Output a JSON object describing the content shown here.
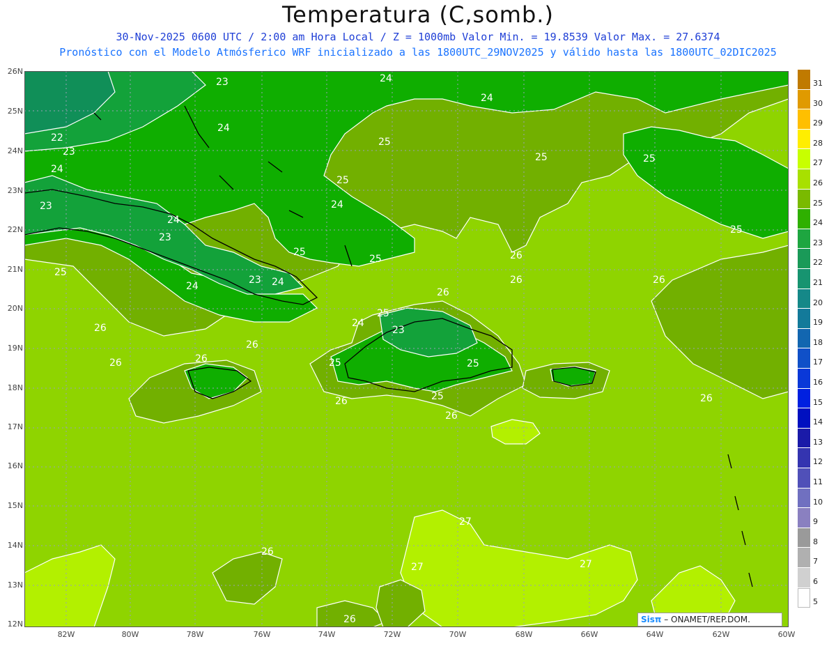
{
  "header": {
    "title": "Temperatura (C,somb.)",
    "subtitle": "30-Nov-2025  0600 UTC / 2:00 am Hora Local / Z = 1000mb   Valor Min. = 19.8539  Valor Max. = 27.6374",
    "subtitle2": "Pronóstico con el Modelo Atmósferico WRF inicializado a las 1800UTC_29NOV2025 y válido hasta las  1800UTC_02DIC2025"
  },
  "axes": {
    "lat_labels": [
      "26N",
      "25N",
      "24N",
      "23N",
      "22N",
      "21N",
      "20N",
      "19N",
      "18N",
      "17N",
      "16N",
      "15N",
      "14N",
      "13N",
      "12N"
    ],
    "lon_labels": [
      "82W",
      "80W",
      "78W",
      "76W",
      "74W",
      "72W",
      "70W",
      "68W",
      "66W",
      "64W",
      "62W",
      "60W"
    ]
  },
  "colorbar": {
    "levels": [
      "31",
      "30",
      "29",
      "28",
      "27",
      "26",
      "25",
      "24",
      "23",
      "22",
      "21",
      "20",
      "19",
      "18",
      "17",
      "16",
      "15",
      "14",
      "13",
      "12",
      "11",
      "10",
      "9",
      "8",
      "7",
      "6",
      "5"
    ],
    "colors": [
      "#c07a00",
      "#e09a00",
      "#ffbf00",
      "#ffee00",
      "#c8ff00",
      "#a8e000",
      "#7aba00",
      "#2fb000",
      "#1ea640",
      "#1a9a58",
      "#179470",
      "#158888",
      "#137a9a",
      "#1266b0",
      "#1050c8",
      "#0a38d8",
      "#0020e0",
      "#0010c0",
      "#1a1aa8",
      "#3434b0",
      "#5050b8",
      "#7070c0",
      "#8a80c0",
      "#9a9a9a",
      "#b0b0b0",
      "#d0d0d0",
      "#ffffff"
    ]
  },
  "contour_labels": [
    "23",
    "24",
    "24",
    "22",
    "23",
    "24",
    "24",
    "23",
    "25",
    "24",
    "25",
    "23",
    "24",
    "23",
    "24",
    "25",
    "25",
    "25",
    "26",
    "26",
    "24",
    "25",
    "23",
    "24",
    "25",
    "26",
    "25",
    "25",
    "26",
    "26",
    "26",
    "26",
    "26",
    "26",
    "26",
    "27",
    "27",
    "27",
    "26",
    "26",
    "25",
    "26",
    "25",
    "25"
  ],
  "legend_colors": {
    "t27": "#b3f000",
    "t26": "#8fd400",
    "t25": "#72b000",
    "t24": "#0fae00",
    "t23": "#13a23a",
    "t22": "#108f58",
    "coast": "#000000",
    "grid": "#9aa0b8"
  },
  "credit": {
    "brand": "Sisπ",
    "org": "– ONAMET/REP.DOM."
  }
}
